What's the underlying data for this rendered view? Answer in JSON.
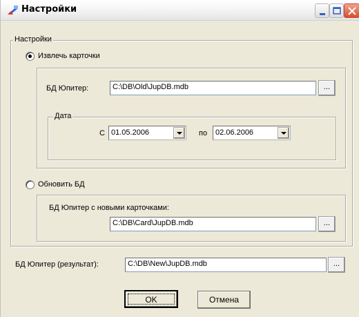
{
  "window": {
    "title": "Настройки"
  },
  "settings_group": {
    "title": "Настройки"
  },
  "extract": {
    "radio_label": "Извлечь карточки",
    "selected": true,
    "db_label": "БД Юпитер:",
    "db_path": "C:\\DB\\Old\\JupDB.mdb",
    "browse_label": "...",
    "date_group": {
      "title": "Дата",
      "from_label": "С",
      "from_value": "01.05.2006",
      "to_label": "по",
      "to_value": "02.06.2006"
    }
  },
  "update": {
    "radio_label": "Обновить БД",
    "selected": false,
    "cards_db_label": "БД Юпитер с новыми карточками:",
    "cards_db_path": "C:\\DB\\Card\\JupDB.mdb",
    "browse_label": "..."
  },
  "result": {
    "label": "БД Юпитер (результат):",
    "path": "C:\\DB\\New\\JupDB.mdb",
    "browse_label": "..."
  },
  "buttons": {
    "ok_label": "OK",
    "cancel_label": "Отмена"
  },
  "icons": {
    "app": "app-icon",
    "minimize": "minimize-icon",
    "maximize": "maximize-icon",
    "close": "close-icon",
    "dropdown": "chevron-down-icon"
  }
}
